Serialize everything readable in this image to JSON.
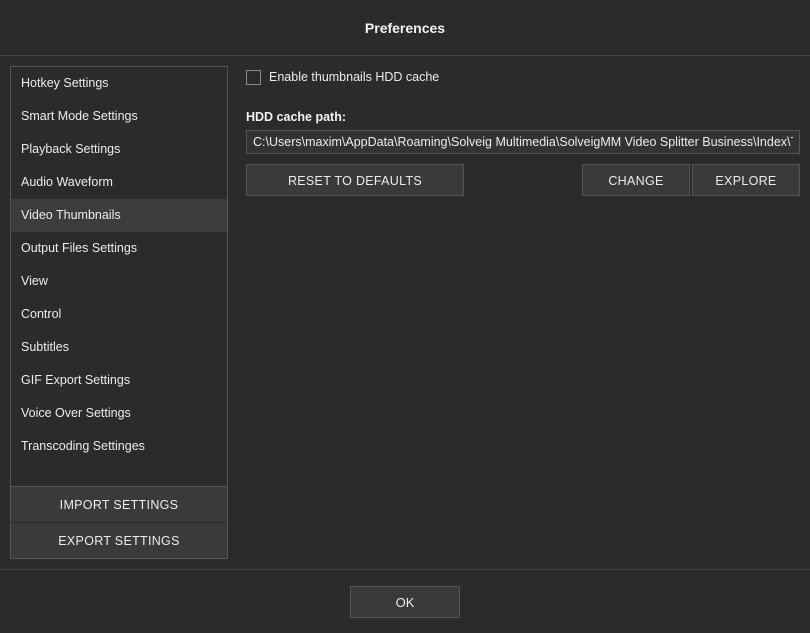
{
  "title": "Preferences",
  "sidebar": {
    "items": [
      {
        "label": "Hotkey Settings"
      },
      {
        "label": "Smart Mode Settings"
      },
      {
        "label": "Playback Settings"
      },
      {
        "label": "Audio Waveform"
      },
      {
        "label": "Video Thumbnails"
      },
      {
        "label": "Output Files Settings"
      },
      {
        "label": "View"
      },
      {
        "label": "Control"
      },
      {
        "label": "Subtitles"
      },
      {
        "label": "GIF Export Settings"
      },
      {
        "label": "Voice Over Settings"
      },
      {
        "label": "Transcoding Settinges"
      }
    ],
    "active_index": 4,
    "import_label": "IMPORT SETTINGS",
    "export_label": "EXPORT SETTINGS"
  },
  "content": {
    "enable_cache_label": "Enable thumbnails HDD cache",
    "enable_cache_checked": false,
    "path_label": "HDD cache path:",
    "path_value": "C:\\Users\\maxim\\AppData\\Roaming\\Solveig Multimedia\\SolveigMM Video Splitter Business\\Index\\Thu",
    "reset_label": "RESET TO DEFAULTS",
    "change_label": "CHANGE",
    "explore_label": "EXPLORE"
  },
  "footer": {
    "ok_label": "OK"
  }
}
